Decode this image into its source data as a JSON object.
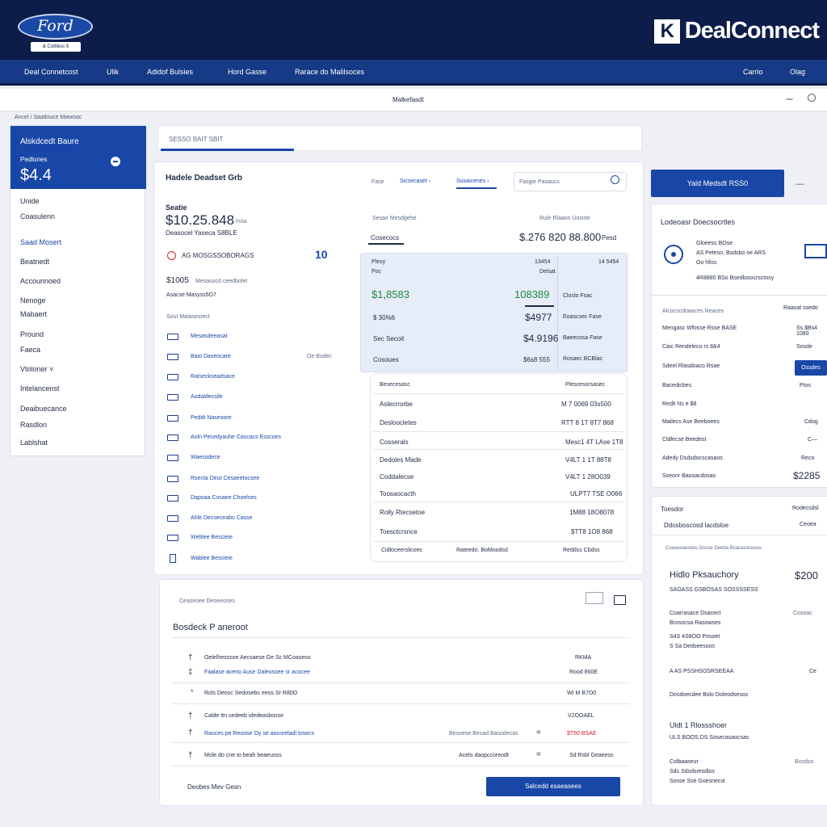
{
  "header": {
    "logo_text": "Ford",
    "logo_sub": "& Cottless 5",
    "brand_name": "DealConnect",
    "brand_mark": "K"
  },
  "nav": {
    "items": [
      "Deal Connetcost",
      "Ulik",
      "Adidof Bulsies",
      "Hord Gasse",
      "Rarace do Malilsoces"
    ],
    "right_items": [
      "Carrio",
      "Olag"
    ]
  },
  "toolbar": {
    "title": "Malkefasdt"
  },
  "breadcrumb": "Ancel / Saatlouce Mwwsoc",
  "sidebar": {
    "head_title": "Alskdcedt   Baure",
    "head_sub": "Pedlones",
    "head_value": "$4.4",
    "items": [
      "Unide",
      "Coasulenn",
      "Saad Mosert",
      "Beatnedt",
      "Accounnoed",
      "Nenoge",
      "Mabaert",
      "Pround",
      "Faeca",
      "Vtoloner",
      "Intelancenst",
      "Deaibuecance",
      "Rasdlon",
      "Lablshat"
    ],
    "active_item": "Saad Mosert"
  },
  "tabbar": {
    "label": "SESSO BAIT SBIT"
  },
  "main": {
    "title": "Hadele Deadset Grb",
    "filter_1": "Fase",
    "filter_2": "Sicsecaset",
    "filter_3": "Susaicenes",
    "search_placeholder": "Fasgie Pasaucs",
    "metric_label": "Seatie",
    "metric_value": "$10.25.848",
    "metric_unit": "Pofal",
    "metric_sub": "Deasocel Yaseca S8BLE",
    "alert_text": "AG MOSGSSOBORAGS",
    "alert_badge": "10",
    "amount_label": "$1005",
    "amount_sub": "Mesasocd ceedbolet",
    "amount_row2": "Asacse Masyss5O7",
    "list_header": "Sout Malasestect",
    "list_items": [
      "Mesasdeeasat",
      "Baio Daseocare",
      "Ralseckseadsace",
      "Aodaldecsile",
      "Peddt Naseoore",
      "Aoln Pecedyauhe Cascacs Esscoes",
      "Waesodece",
      "Rsecta Deut Cesaeetocsee",
      "Dapoaa Cosaee Choelses",
      "Ahle Decseceabo Casse",
      "Weblee Bescieie"
    ],
    "list_value": "Oe Bsdec"
  },
  "summary": {
    "head_left": "Sesae Mesdgehe",
    "head_right": "Rule Rlaaon Uosnte",
    "tab_label": "Cosecocs",
    "total": "$.276 820 88.800",
    "total_unit": "Pesd",
    "columns": [
      "Plesy",
      "13454",
      "14 5454"
    ],
    "col_sub": [
      "Poc",
      "Delsat"
    ],
    "rows": [
      {
        "a": "$1,8583",
        "b": "108389",
        "c": "Cloclo Fsac"
      },
      {
        "a": "$ 30%6",
        "b": "$4977",
        "c": "Eoascsec Fase"
      },
      {
        "a": "Sec Secoit",
        "b": "$4.9196",
        "c": "Baeecosa Fase"
      },
      {
        "a": "Cosoues",
        "b": "$6s8 555",
        "c": "Rosaec BCBlac"
      }
    ]
  },
  "detail_table": {
    "header_left": "Besecesasc",
    "header_right": "Plescesorsasec",
    "rows": [
      {
        "label": "Aslecrrorbe",
        "value": "M 7 0069 03s500"
      },
      {
        "label": "Desloocletes",
        "value": "RTT 8 1T 8T7 868"
      },
      {
        "label": "Cosserals",
        "value": "Mesc1 4T LAse 1T8"
      },
      {
        "label": "Dedoles Made",
        "value": "V4LT 1 1T 88T8"
      },
      {
        "label": "Coddalecse",
        "value": "V4LT 1 28O039"
      },
      {
        "label": "Toosaocacth",
        "value": "ULPT7 TSE O066"
      },
      {
        "label": "Rolly Rtecsetoe",
        "value": "1M88 18O8078"
      },
      {
        "label": "Toesctcrsnce",
        "value": "$TT8 1O8 868"
      }
    ],
    "footer_left": "Cidloceerslicoec",
    "footer_mid": "Rateedo. BoMoodsd",
    "footer_right": "Reddss Cbdss"
  },
  "payment": {
    "crumb": "Ceasesee Deoeeoses",
    "title": "Bosdeck P aneroot",
    "rows": [
      {
        "icon": "†",
        "label": "Oelelhesssoe Aecsaese Ge Sc MCoaseso",
        "value": "RKMA",
        "type": "normal"
      },
      {
        "icon": "‡",
        "label": "Faalase aceno Ause Daleossee sr acocee",
        "value": "Rood 860E",
        "type": "normal"
      },
      {
        "icon": "*",
        "label": "Rols Deosc Sedosebs eeos Sr R80O",
        "value": "WI M B7O0",
        "type": "normal"
      },
      {
        "icon": "†",
        "label": "Calde ttn sedeeb idedeasbosse",
        "value": "V2OOAEL",
        "type": "normal"
      },
      {
        "icon": "†",
        "label": "Raoces pe Reoose Oy se aocoreladl tosecs",
        "value": "$T60 BSAE",
        "type": "alert"
      },
      {
        "icon": "†",
        "label": "Mole do cne to beah beaeuoss",
        "value": "Sd:Rsbl Geaeess",
        "type": "normal"
      }
    ],
    "mid_label_1": "Besoese Besad Basodecas",
    "mid_label_2": "Acelo daopccoreodt",
    "footer_left": "Deobes Mev Gesn",
    "button": "Salcedd esaeasees"
  },
  "right_panel": {
    "button": "Yald Medsdt RSS0",
    "section_title": "Lodeoasr Doecsocrtles",
    "info_lines": [
      "Gloeess BOse",
      "AS Peteso, Bsdsbo oe ARS",
      "Oo hfiss"
    ],
    "info_sub": "4R8880 BSo Bsedlosocrsctosy",
    "table_header": "Alcocscdoaaces Neaces",
    "table_header_value": "Raasat ssedo",
    "rows": [
      {
        "label": "Mengasc Wfosse Rsse BASE",
        "value": "Ss $Bs4 1080"
      },
      {
        "label": "Caic Rendeleco rs 8&4",
        "value": "Sosde"
      },
      {
        "label": "Sdeel Rlasdoaco Rsae",
        "value": "Saces"
      },
      {
        "label": "Bacedicbes",
        "value": "Ptos"
      },
      {
        "label": "Redlt Ns e $8",
        "value": ""
      },
      {
        "label": "Mailecs Ase Beeboees",
        "value": "Cdog"
      },
      {
        "label": "Cldlecse Beedest",
        "value": "C—"
      },
      {
        "label": "Adedy Dsdsdocscasaos",
        "value": "Reco"
      },
      {
        "label": "Sseonr Baosacdosas",
        "value": "$2285"
      }
    ],
    "badge": "Ossdes"
  },
  "history": {
    "head_left": "Toesdor",
    "head_right": "Rodecsdsl",
    "sub_left": "Ddosboscosd lacdsloe",
    "sub_right": "Ceoea",
    "line": "Coaoesaesdos Dsose Deeba Bsacasdcesuo",
    "title": "Hidlo Pksauchory",
    "title_value": "$200",
    "title_sub": "SAOASS GSBOSAS SOSSSSESS",
    "items": [
      "Coarrasace Dsacect",
      "Brosocsa  Rasowses",
      "S4S 4S8OO Posoet",
      "S Sa Dedseesoos",
      "A AS PSSHSOSRSEEAA"
    ],
    "item_right": "Cosoac",
    "item_footer": "Dosdoecdee Bslo Doleodsesos",
    "sub_title": "Uldt 1 Rlossshoer",
    "sub_line": "ULS BOOS DS Sosecasaocsas",
    "bottom": [
      "Colbaaseur",
      "Sds Sdsdsresdlos",
      "Sosse Sse Goesnecst"
    ],
    "bottom_right": "Bosdso"
  }
}
